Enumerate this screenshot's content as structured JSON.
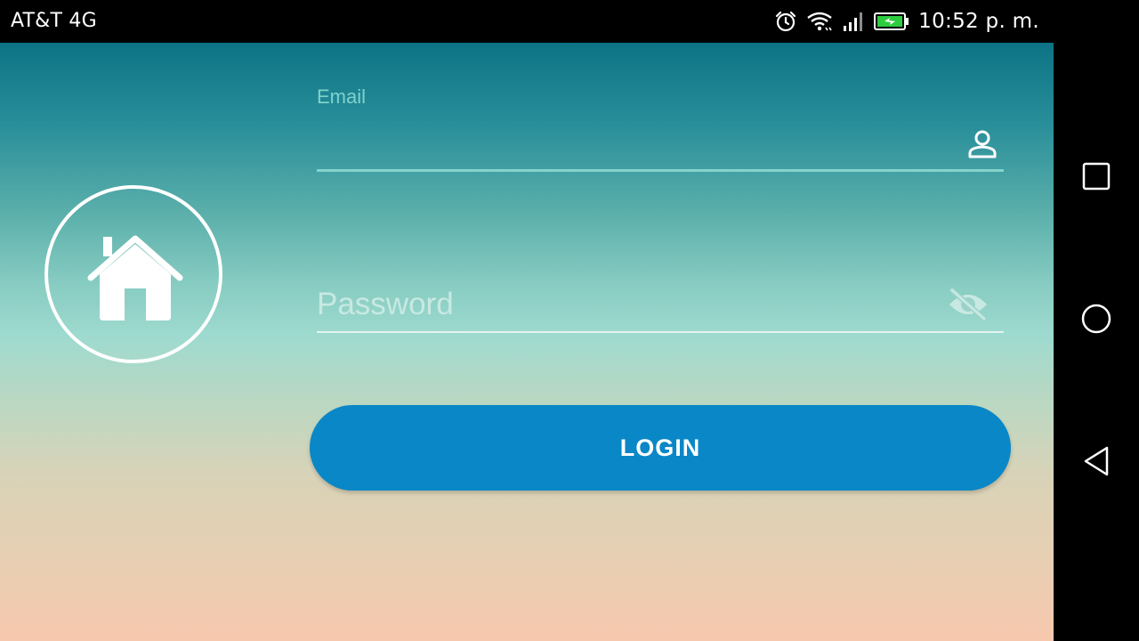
{
  "status_bar": {
    "carrier": "AT&T 4G",
    "time": "10:52 p. m.",
    "icons": [
      "alarm-icon",
      "wifi-icon",
      "signal-icon",
      "battery-charging-icon"
    ]
  },
  "login": {
    "email_label": "Email",
    "email_value": "",
    "password_placeholder": "Password",
    "login_button": "LOGIN",
    "icons": [
      "home-icon",
      "person-icon",
      "eye-off-icon"
    ]
  },
  "nav_bar": {
    "icons": [
      "recents-square-icon",
      "home-circle-icon",
      "back-triangle-icon"
    ]
  },
  "colors": {
    "gradient_top": "#0b7385",
    "gradient_mid": "#9edacf",
    "gradient_bottom": "#f7c8ae",
    "button": "#0a87c7",
    "battery": "#2ecc40"
  }
}
